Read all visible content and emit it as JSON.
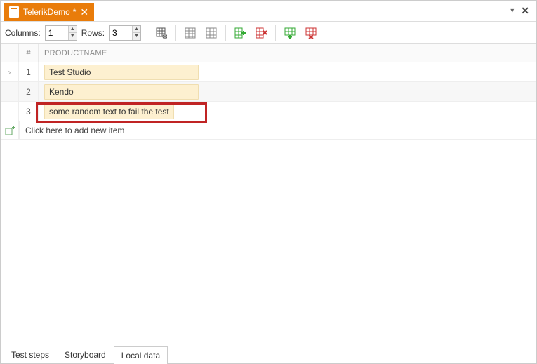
{
  "tab": {
    "title": "TelerikDemo",
    "modified": "*"
  },
  "toolbar": {
    "columns_label": "Columns:",
    "columns_value": "1",
    "rows_label": "Rows:",
    "rows_value": "3"
  },
  "grid": {
    "headers": {
      "num": "#",
      "col1": "PRODUCTNAME"
    },
    "rows": [
      {
        "n": "1",
        "val": "Test Studio"
      },
      {
        "n": "2",
        "val": "Kendo"
      },
      {
        "n": "3",
        "val": "some random text to fail the test"
      }
    ],
    "add_hint": "Click here to add new item"
  },
  "bottom_tabs": {
    "t1": "Test steps",
    "t2": "Storyboard",
    "t3": "Local data"
  }
}
